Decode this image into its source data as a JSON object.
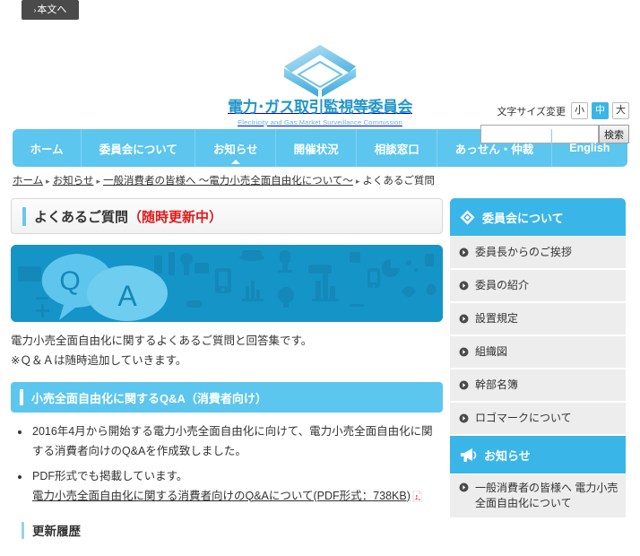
{
  "skip": {
    "label": "本文へ",
    "caret": "›"
  },
  "header": {
    "logo_jp": "電力･ガス取引監視等委員会",
    "logo_en": "Electricity and Gas Market Surveillance Commission",
    "logo_icon": "hexagon-book-logo-icon",
    "fontsize_label": "文字サイズ変更",
    "fontsize_options": [
      {
        "label": "小",
        "name": "small",
        "active": false
      },
      {
        "label": "中",
        "name": "medium",
        "active": true
      },
      {
        "label": "大",
        "name": "large",
        "active": false
      }
    ],
    "search": {
      "value": "",
      "placeholder": "",
      "button_label": "検索"
    },
    "accent_color": "#3ab5e8"
  },
  "gnav": {
    "items": [
      {
        "label": "ホーム",
        "active": false
      },
      {
        "label": "委員会について",
        "active": false
      },
      {
        "label": "お知らせ",
        "active": true
      },
      {
        "label": "開催状況",
        "active": false
      },
      {
        "label": "相談窓口",
        "active": false
      },
      {
        "label": "あっせん・仲裁",
        "active": false
      },
      {
        "label": "English",
        "active": false
      }
    ],
    "bg_color": "#5cc6ee"
  },
  "breadcrumb": {
    "items": [
      {
        "label": "ホーム",
        "link": true
      },
      {
        "label": "お知らせ",
        "link": true
      },
      {
        "label": "一般消費者の皆様へ ～電力小売全面自由化について～",
        "link": true
      },
      {
        "label": "よくあるご質問",
        "link": false
      }
    ],
    "separator": "▸"
  },
  "main": {
    "page_title": "よくあるご質問",
    "page_title_highlight": "（随時更新中）",
    "hero": {
      "name": "qa-banner",
      "q_letter": "Q",
      "a_letter": "A",
      "bg_color": "#1594c8",
      "bubble_color": "#5ec5ec"
    },
    "lead_line1": "電力小売全面自由化に関するよくあるご質問と回答集です。",
    "lead_line2": "※Ｑ＆Ａは随時追加していきます。",
    "section_title": "小売全面自由化に関するQ&A（消費者向け）",
    "bullets": [
      {
        "text": "2016年4月から開始する電力小売全面自由化に向けて、電力小売全面自由化に関する消費者向けのQ&Aを作成致しました。",
        "link": null
      },
      {
        "text": "PDF形式でも掲載しています。",
        "link": "電力小売全面自由化に関する消費者向けのQ&Aについて(PDF形式：738KB)"
      }
    ],
    "history_title": "更新履歴"
  },
  "sidebar": {
    "sections": [
      {
        "header": "委員会について",
        "header_icon": "diamond-icon",
        "items": [
          {
            "label": "委員長からのご挨拶"
          },
          {
            "label": "委員の紹介"
          },
          {
            "label": "設置規定"
          },
          {
            "label": "組織図"
          },
          {
            "label": "幹部名簿"
          },
          {
            "label": "ロゴマークについて"
          }
        ]
      },
      {
        "header": "お知らせ",
        "header_icon": "megaphone-icon",
        "items": [
          {
            "label": "一般消費者の皆様へ\n電力小売全面自由化について"
          }
        ]
      }
    ],
    "item_bg": "#ededed",
    "header_bg": "#3ab5e8"
  }
}
